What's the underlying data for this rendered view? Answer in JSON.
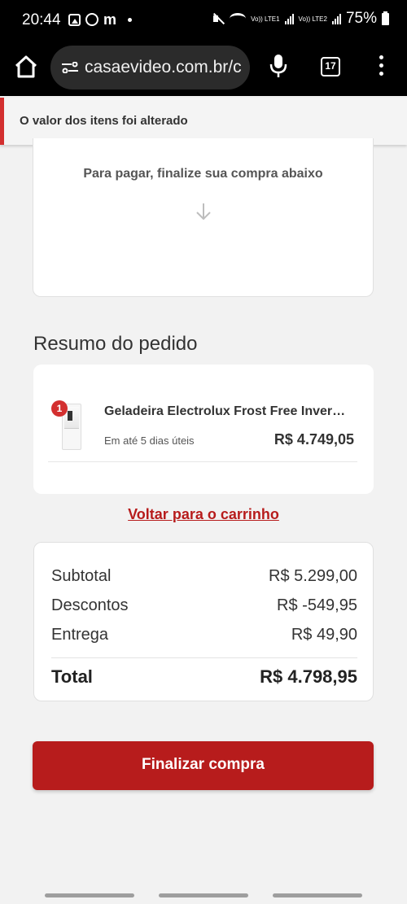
{
  "status_bar": {
    "time": "20:44",
    "volte1": "Vo)) LTE1",
    "volte2": "Vo)) LTE2",
    "battery": "75%"
  },
  "browser": {
    "url": "casaevideo.com.br/c",
    "tab_count": "17"
  },
  "notice": {
    "text": "O valor dos itens foi alterado",
    "color": "#d32f2f"
  },
  "payment": {
    "message": "Para pagar, finalize sua compra abaixo"
  },
  "order_summary": {
    "title": "Resumo do pedido",
    "item": {
      "quantity": "1",
      "name": "Geladeira Electrolux Frost Free Inverter…",
      "delivery": "Em até 5 dias úteis",
      "price": "R$ 4.749,05"
    },
    "back_link": "Voltar para o carrinho"
  },
  "totals": {
    "subtotal_label": "Subtotal",
    "subtotal_value": "R$ 5.299,00",
    "discount_label": "Descontos",
    "discount_value": "R$ -549,95",
    "shipping_label": "Entrega",
    "shipping_value": "R$ 49,90",
    "total_label": "Total",
    "total_value": "R$ 4.798,95"
  },
  "checkout_button": "Finalizar compra",
  "colors": {
    "accent": "#b71c1c"
  }
}
